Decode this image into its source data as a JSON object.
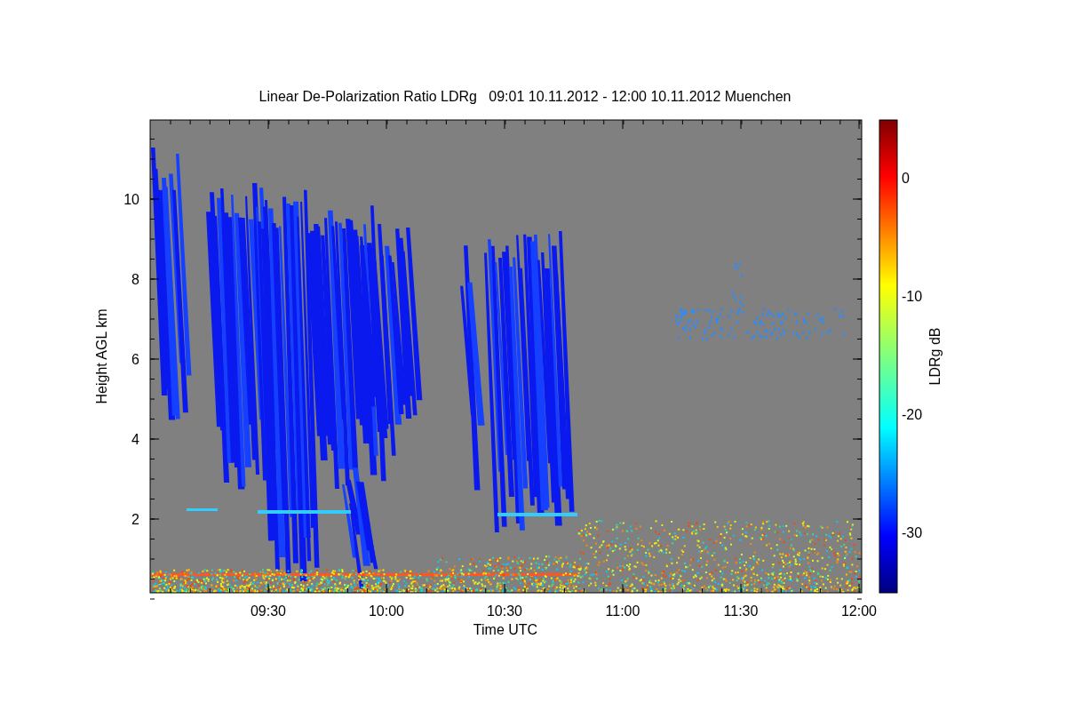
{
  "title": "Linear De-Polarization Ratio LDRg   09:01 10.11.2012 - 12:00 10.11.2012 Muenchen",
  "y_axis": {
    "label": "Height AGL km",
    "ticks": [
      "10",
      "8",
      "6",
      "4",
      "2"
    ]
  },
  "x_axis": {
    "label": "Time UTC",
    "ticks": [
      "09:30",
      "10:00",
      "10:30",
      "11:00",
      "11:30",
      "12:00"
    ]
  },
  "colorbar": {
    "label": "LDRg dB",
    "ticks": [
      "0",
      "-10",
      "-20",
      "-30"
    ]
  }
}
